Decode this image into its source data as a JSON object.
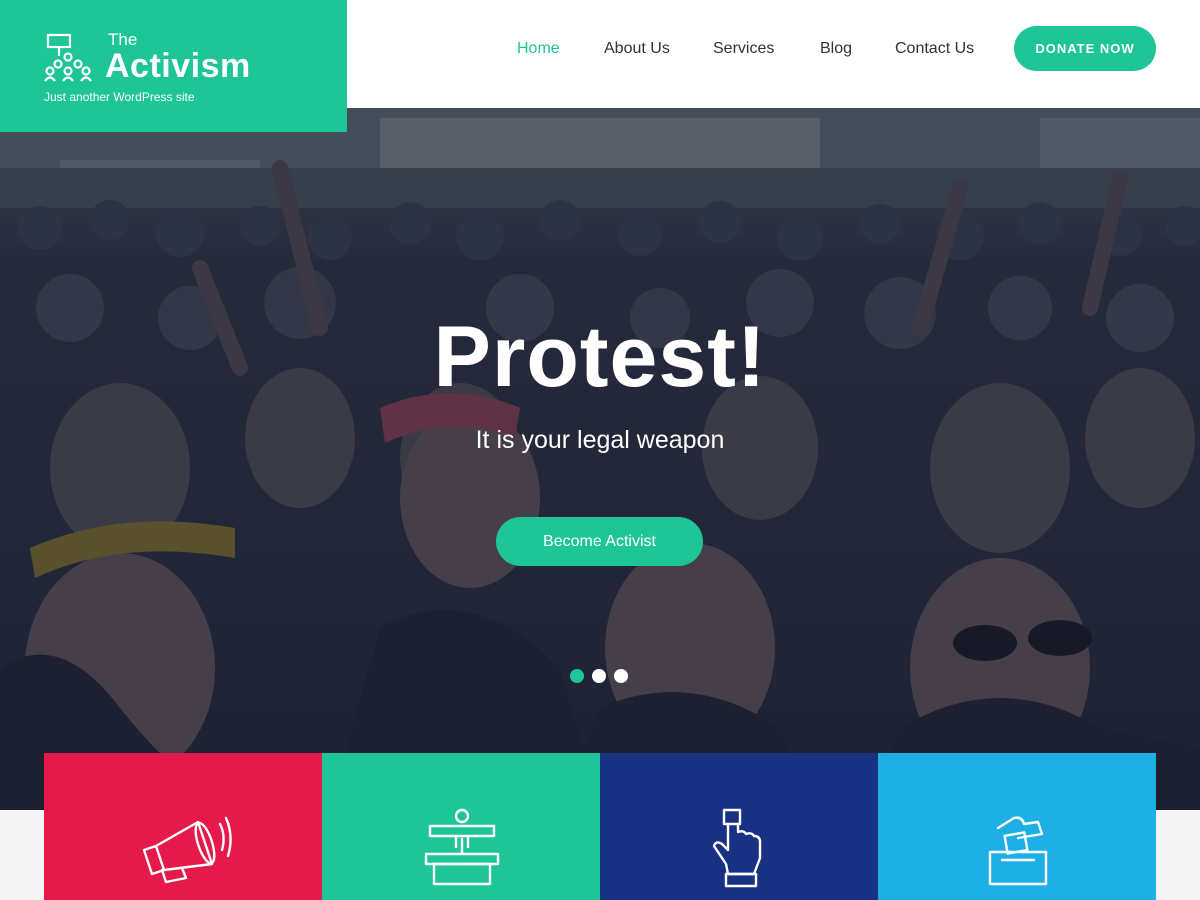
{
  "site": {
    "logo_prefix": "The",
    "logo_title": "Activism",
    "tagline": "Just another WordPress site",
    "logo_icon": "protest-crowd-icon",
    "accent_color": "#1ec597"
  },
  "nav": {
    "items": [
      {
        "label": "Home",
        "active": true
      },
      {
        "label": "About Us",
        "active": false
      },
      {
        "label": "Services",
        "active": false
      },
      {
        "label": "Blog",
        "active": false
      },
      {
        "label": "Contact Us",
        "active": false
      }
    ],
    "donate_label": "DONATE NOW"
  },
  "hero": {
    "title": "Protest!",
    "subtitle": "It is your legal weapon",
    "button_label": "Become Activist",
    "slides_total": 3,
    "active_slide": 1
  },
  "features": [
    {
      "icon": "megaphone-icon",
      "color": "#e5194a"
    },
    {
      "icon": "podium-speaker-icon",
      "color": "#1ec597"
    },
    {
      "icon": "hand-press-button-icon",
      "color": "#183182"
    },
    {
      "icon": "ballot-box-icon",
      "color": "#1eafe6"
    }
  ]
}
